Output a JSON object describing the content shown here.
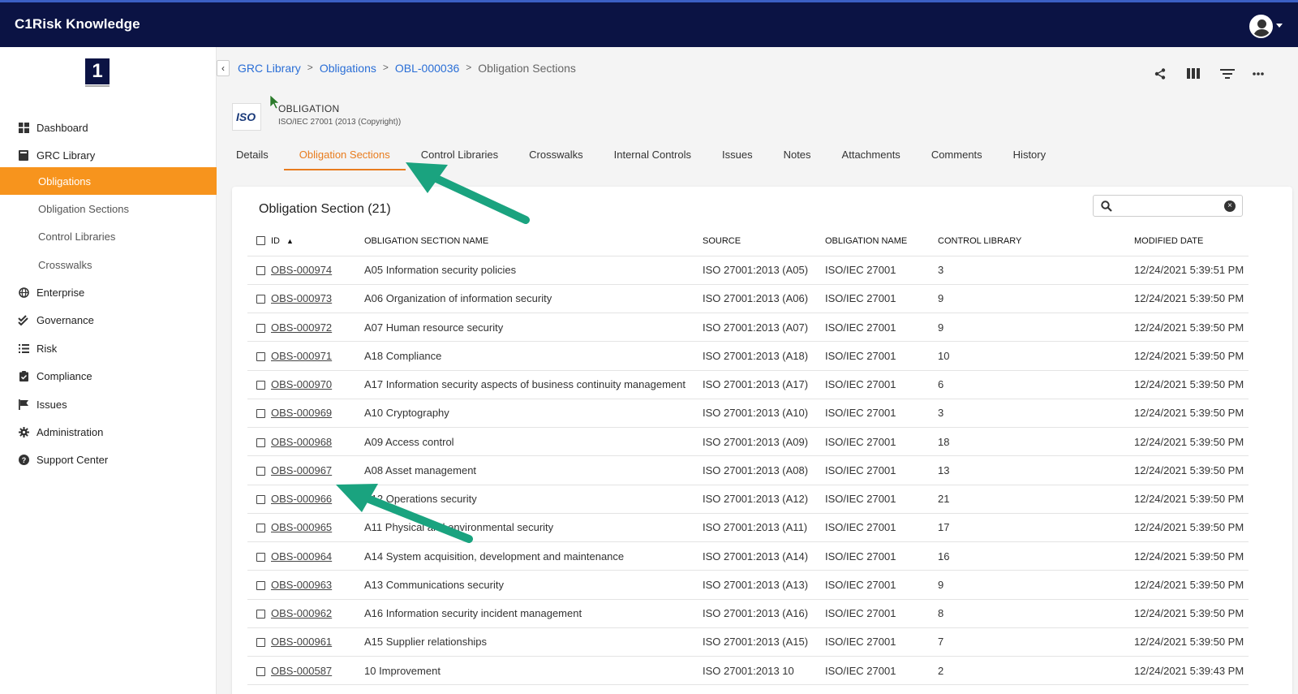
{
  "app": {
    "title": "C1Risk Knowledge"
  },
  "sidebar": {
    "items": [
      {
        "label": "Dashboard",
        "icon": "dashboard-icon"
      },
      {
        "label": "GRC Library",
        "icon": "book-icon"
      },
      {
        "label": "Obligations",
        "sub": true,
        "active": true
      },
      {
        "label": "Obligation Sections",
        "sub": true
      },
      {
        "label": "Control Libraries",
        "sub": true
      },
      {
        "label": "Crosswalks",
        "sub": true
      },
      {
        "label": "Enterprise",
        "icon": "globe-icon"
      },
      {
        "label": "Governance",
        "icon": "check-double-icon"
      },
      {
        "label": "Risk",
        "icon": "list-icon"
      },
      {
        "label": "Compliance",
        "icon": "clipboard-check-icon"
      },
      {
        "label": "Issues",
        "icon": "flag-icon"
      },
      {
        "label": "Administration",
        "icon": "gear-icon"
      },
      {
        "label": "Support Center",
        "icon": "question-circle-icon"
      }
    ]
  },
  "breadcrumb": [
    "GRC Library",
    "Obligations",
    "OBL-000036",
    "Obligation Sections"
  ],
  "object": {
    "type": "OBLIGATION",
    "name": "ISO/IEC 27001 (2013 (Copyright))",
    "badge": "ISO"
  },
  "tabs": [
    "Details",
    "Obligation Sections",
    "Control Libraries",
    "Crosswalks",
    "Internal Controls",
    "Issues",
    "Notes",
    "Attachments",
    "Comments",
    "History"
  ],
  "active_tab": "Obligation Sections",
  "card": {
    "title": "Obligation Section (21)",
    "search_placeholder": ""
  },
  "table": {
    "columns": [
      "ID",
      "OBLIGATION SECTION NAME",
      "SOURCE",
      "OBLIGATION NAME",
      "CONTROL LIBRARY",
      "MODIFIED DATE"
    ],
    "rows": [
      [
        "OBS-000974",
        "A05 Information security policies",
        "ISO 27001:2013 (A05)",
        "ISO/IEC 27001",
        "3",
        "12/24/2021 5:39:51 PM"
      ],
      [
        "OBS-000973",
        "A06 Organization of information security",
        "ISO 27001:2013 (A06)",
        "ISO/IEC 27001",
        "9",
        "12/24/2021 5:39:50 PM"
      ],
      [
        "OBS-000972",
        "A07 Human resource security",
        "ISO 27001:2013 (A07)",
        "ISO/IEC 27001",
        "9",
        "12/24/2021 5:39:50 PM"
      ],
      [
        "OBS-000971",
        "A18 Compliance",
        "ISO 27001:2013 (A18)",
        "ISO/IEC 27001",
        "10",
        "12/24/2021 5:39:50 PM"
      ],
      [
        "OBS-000970",
        "A17 Information security aspects of business continuity management",
        "ISO 27001:2013 (A17)",
        "ISO/IEC 27001",
        "6",
        "12/24/2021 5:39:50 PM"
      ],
      [
        "OBS-000969",
        "A10 Cryptography",
        "ISO 27001:2013 (A10)",
        "ISO/IEC 27001",
        "3",
        "12/24/2021 5:39:50 PM"
      ],
      [
        "OBS-000968",
        "A09 Access control",
        "ISO 27001:2013 (A09)",
        "ISO/IEC 27001",
        "18",
        "12/24/2021 5:39:50 PM"
      ],
      [
        "OBS-000967",
        "A08 Asset management",
        "ISO 27001:2013 (A08)",
        "ISO/IEC 27001",
        "13",
        "12/24/2021 5:39:50 PM"
      ],
      [
        "OBS-000966",
        "A12 Operations security",
        "ISO 27001:2013 (A12)",
        "ISO/IEC 27001",
        "21",
        "12/24/2021 5:39:50 PM"
      ],
      [
        "OBS-000965",
        "A11 Physical and environmental security",
        "ISO 27001:2013 (A11)",
        "ISO/IEC 27001",
        "17",
        "12/24/2021 5:39:50 PM"
      ],
      [
        "OBS-000964",
        "A14 System acquisition, development and maintenance",
        "ISO 27001:2013 (A14)",
        "ISO/IEC 27001",
        "16",
        "12/24/2021 5:39:50 PM"
      ],
      [
        "OBS-000963",
        "A13 Communications security",
        "ISO 27001:2013 (A13)",
        "ISO/IEC 27001",
        "9",
        "12/24/2021 5:39:50 PM"
      ],
      [
        "OBS-000962",
        "A16 Information security incident management",
        "ISO 27001:2013 (A16)",
        "ISO/IEC 27001",
        "8",
        "12/24/2021 5:39:50 PM"
      ],
      [
        "OBS-000961",
        "A15 Supplier relationships",
        "ISO 27001:2013 (A15)",
        "ISO/IEC 27001",
        "7",
        "12/24/2021 5:39:50 PM"
      ],
      [
        "OBS-000587",
        "10 Improvement",
        "ISO 27001:2013 10",
        "ISO/IEC 27001",
        "2",
        "12/24/2021 5:39:43 PM"
      ]
    ]
  },
  "colors": {
    "topbar": "#0b1344",
    "accent": "#f7941d",
    "link": "#2a6ed6",
    "annotation_arrow": "#1aa37f"
  }
}
